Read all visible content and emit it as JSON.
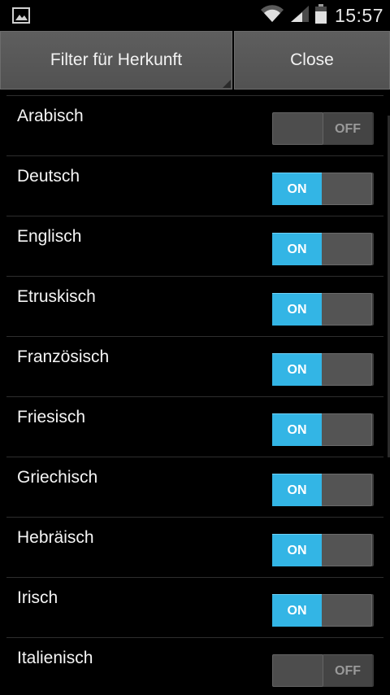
{
  "status_bar": {
    "time": "15:57",
    "icons": [
      "image-notification-icon",
      "wifi-icon",
      "signal-icon",
      "battery-icon"
    ]
  },
  "header": {
    "filter_label": "Filter für Herkunft",
    "close_label": "Close"
  },
  "items": [
    {
      "label": "Arabisch",
      "state": "OFF"
    },
    {
      "label": "Deutsch",
      "state": "ON"
    },
    {
      "label": "Englisch",
      "state": "ON"
    },
    {
      "label": "Etruskisch",
      "state": "ON"
    },
    {
      "label": "Französisch",
      "state": "ON"
    },
    {
      "label": "Friesisch",
      "state": "ON"
    },
    {
      "label": "Griechisch",
      "state": "ON"
    },
    {
      "label": "Hebräisch",
      "state": "ON"
    },
    {
      "label": "Irisch",
      "state": "ON"
    },
    {
      "label": "Italienisch",
      "state": "OFF"
    }
  ],
  "colors": {
    "toggle_on": "#33b5e5",
    "background": "#000000",
    "button": "#555555"
  }
}
